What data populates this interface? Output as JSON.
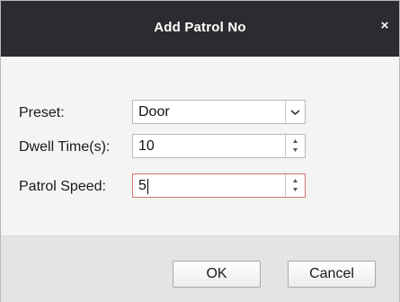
{
  "dialog": {
    "title": "Add Patrol No",
    "close_glyph": "×"
  },
  "form": {
    "preset": {
      "label": "Preset:",
      "value": "Door",
      "icon": "chevron-down-icon"
    },
    "dwell_time": {
      "label": "Dwell Time(s):",
      "value": "10"
    },
    "patrol_speed": {
      "label": "Patrol Speed:",
      "value": "5"
    }
  },
  "buttons": {
    "ok_label": "OK",
    "cancel_label": "Cancel"
  },
  "colors": {
    "titlebar": "#2c2c30",
    "focus_border": "#d9706f"
  }
}
